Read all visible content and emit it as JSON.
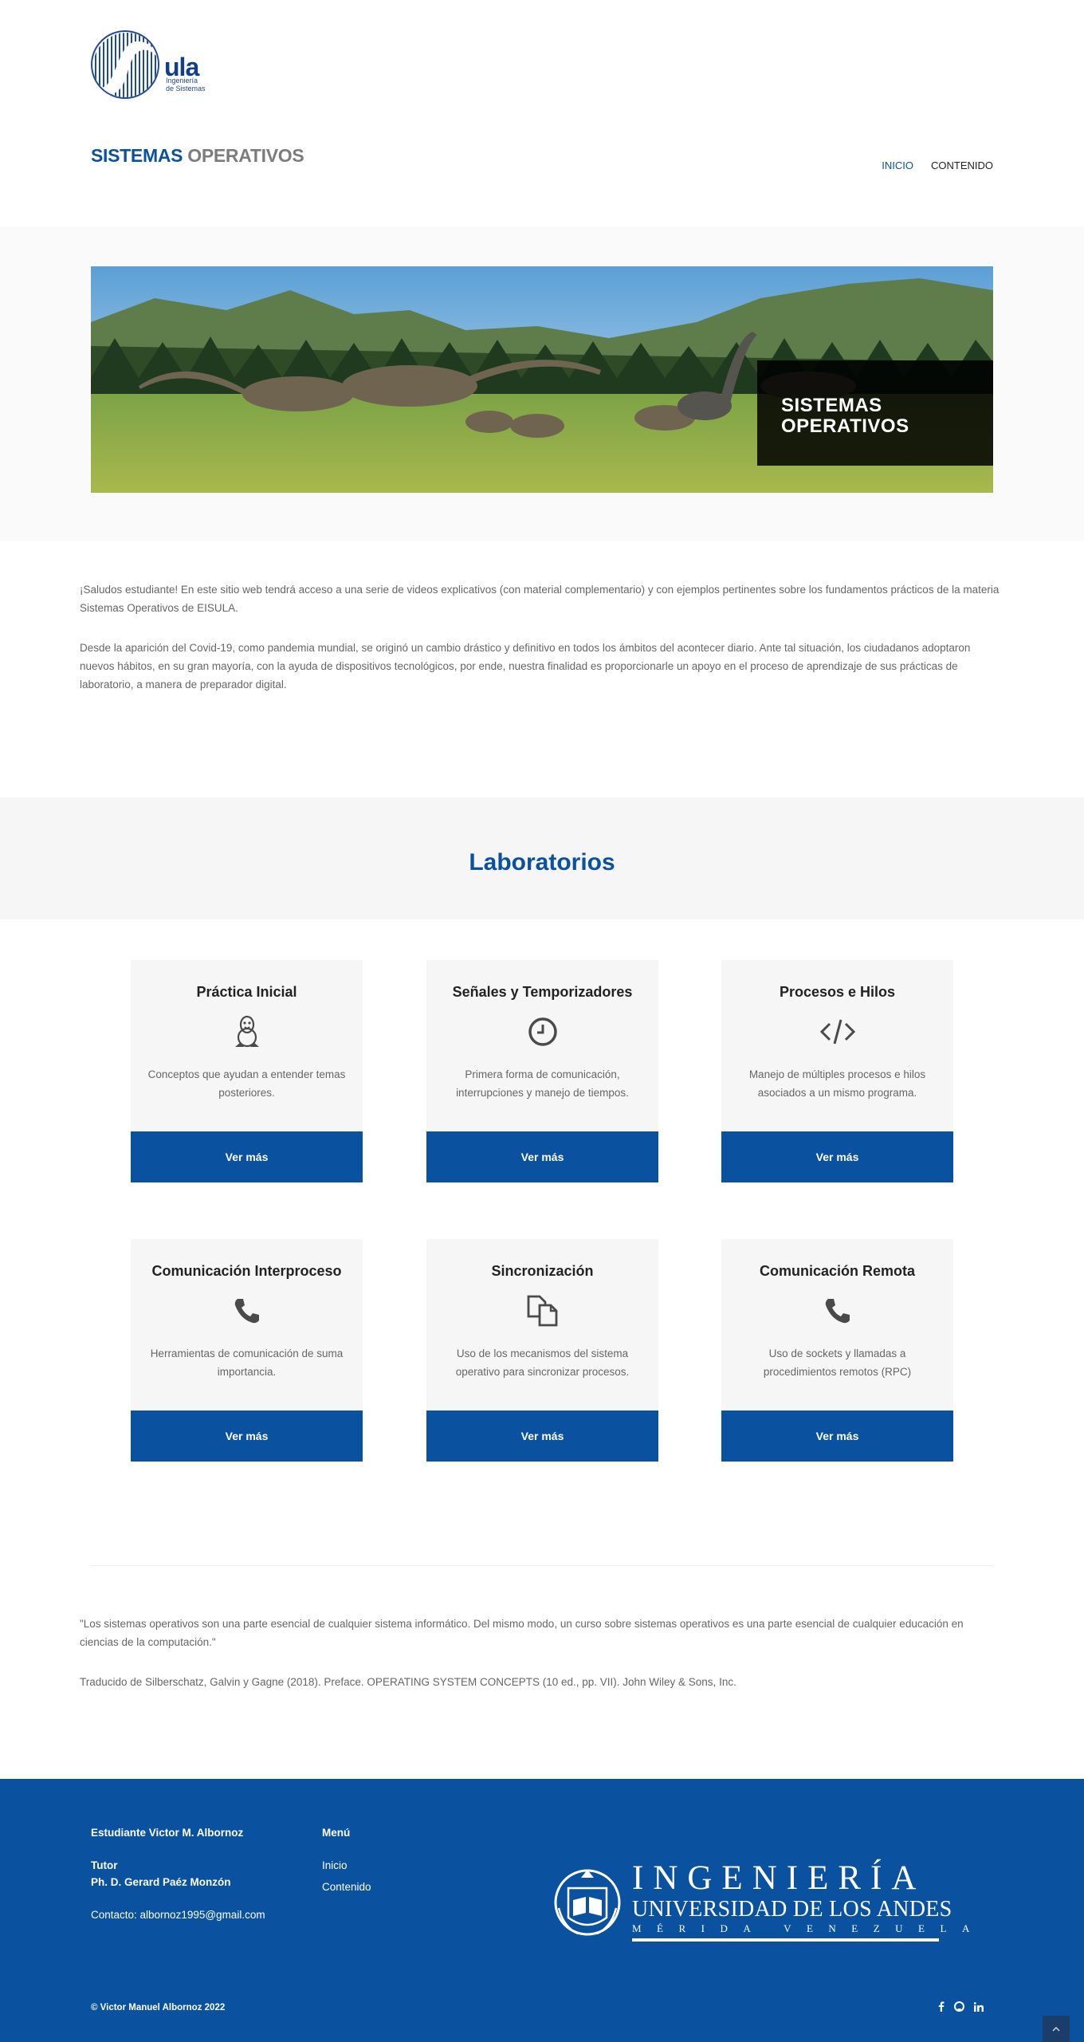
{
  "header": {
    "logo": {
      "word": "ula",
      "sub_line1": "Ingeniería",
      "sub_line2": "de Sistemas"
    },
    "site_title_part1": "SISTEMAS",
    "site_title_part2": "OPERATIVOS",
    "nav": [
      {
        "label": "INICIO",
        "active": true
      },
      {
        "label": "CONTENIDO",
        "active": false
      }
    ]
  },
  "hero": {
    "caption_line1": "SISTEMAS",
    "caption_line2": "OPERATIVOS"
  },
  "intro": {
    "p1": "¡Saludos estudiante! En este sitio web tendrá acceso a una serie de videos explicativos (con material complementario) y con ejemplos pertinentes sobre los fundamentos prácticos de la materia Sistemas Operativos de EISULA.",
    "p2": "Desde la aparición del Covid-19, como pandemia mundial, se originó un cambio drástico y definitivo en todos los ámbitos del acontecer diario. Ante tal situación, los ciudadanos adoptaron nuevos hábitos, en su gran mayoría, con la ayuda de dispositivos tecnológicos, por ende, nuestra finalidad es proporcionarle un apoyo en el proceso de aprendizaje de sus prácticas de laboratorio, a manera de preparador digital."
  },
  "labs": {
    "title": "Laboratorios",
    "cards": [
      {
        "title": "Práctica Inicial",
        "icon": "linux-icon",
        "desc": "Conceptos que ayudan a entender temas posteriores.",
        "button": "Ver más"
      },
      {
        "title": "Señales y Temporizadores",
        "icon": "clock-icon",
        "desc": "Primera forma de comunicación, interrupciones y manejo de tiempos.",
        "button": "Ver más"
      },
      {
        "title": "Procesos e Hilos",
        "icon": "code-icon",
        "desc": "Manejo de múltiples procesos e hilos asociados a un mismo programa.",
        "button": "Ver más"
      },
      {
        "title": "Comunicación Interproceso",
        "icon": "phone-icon",
        "desc": "Herramientas de comunicación de suma importancia.",
        "button": "Ver más"
      },
      {
        "title": "Sincronización",
        "icon": "files-icon",
        "desc": "Uso de los mecanismos del sistema operativo para sincronizar procesos.",
        "button": "Ver más"
      },
      {
        "title": "Comunicación Remota",
        "icon": "phone-icon",
        "desc": "Uso de sockets y llamadas a procedimientos remotos (RPC)",
        "button": "Ver más"
      }
    ]
  },
  "quote": {
    "text": "\"Los sistemas operativos son una parte esencial de cualquier sistema informático. Del mismo modo, un curso sobre sistemas operativos es una parte esencial de cualquier educación en ciencias de la computación.\"",
    "source": "Traducido de Silberschatz, Galvin y Gagne (2018). Preface. OPERATING SYSTEM CONCEPTS (10 ed., pp. VII). John Wiley & Sons, Inc."
  },
  "footer": {
    "student": "Estudiante Victor M. Albornoz",
    "tutor_label": "Tutor",
    "tutor_name": "Ph. D. Gerard Paéz Monzón",
    "contact": "Contacto: albornoz1995@gmail.com",
    "menu_title": "Menú",
    "menu_items": [
      "Inicio",
      "Contenido"
    ],
    "uni_big": "INGENIERÍA",
    "uni_mid": "UNIVERSIDAD DE LOS ANDES",
    "uni_small": "MÉRIDA VENEZUELA",
    "copyright": "© Victor Manuel Albornoz 2022",
    "social": [
      "facebook-icon",
      "github-icon",
      "linkedin-icon"
    ]
  },
  "colors": {
    "brand_blue": "#0a52a0",
    "title_gray": "#7c7c7c",
    "card_bg": "#f6f6f6"
  }
}
